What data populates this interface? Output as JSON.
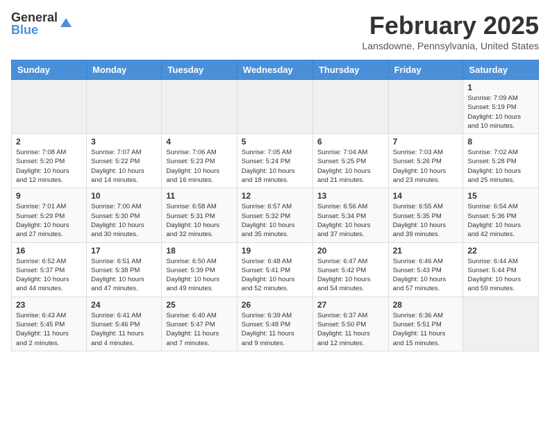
{
  "header": {
    "logo_general": "General",
    "logo_blue": "Blue",
    "month_title": "February 2025",
    "location": "Lansdowne, Pennsylvania, United States"
  },
  "days_of_week": [
    "Sunday",
    "Monday",
    "Tuesday",
    "Wednesday",
    "Thursday",
    "Friday",
    "Saturday"
  ],
  "weeks": [
    [
      {
        "day": "",
        "info": ""
      },
      {
        "day": "",
        "info": ""
      },
      {
        "day": "",
        "info": ""
      },
      {
        "day": "",
        "info": ""
      },
      {
        "day": "",
        "info": ""
      },
      {
        "day": "",
        "info": ""
      },
      {
        "day": "1",
        "info": "Sunrise: 7:09 AM\nSunset: 5:19 PM\nDaylight: 10 hours\nand 10 minutes."
      }
    ],
    [
      {
        "day": "2",
        "info": "Sunrise: 7:08 AM\nSunset: 5:20 PM\nDaylight: 10 hours\nand 12 minutes."
      },
      {
        "day": "3",
        "info": "Sunrise: 7:07 AM\nSunset: 5:22 PM\nDaylight: 10 hours\nand 14 minutes."
      },
      {
        "day": "4",
        "info": "Sunrise: 7:06 AM\nSunset: 5:23 PM\nDaylight: 10 hours\nand 16 minutes."
      },
      {
        "day": "5",
        "info": "Sunrise: 7:05 AM\nSunset: 5:24 PM\nDaylight: 10 hours\nand 18 minutes."
      },
      {
        "day": "6",
        "info": "Sunrise: 7:04 AM\nSunset: 5:25 PM\nDaylight: 10 hours\nand 21 minutes."
      },
      {
        "day": "7",
        "info": "Sunrise: 7:03 AM\nSunset: 5:26 PM\nDaylight: 10 hours\nand 23 minutes."
      },
      {
        "day": "8",
        "info": "Sunrise: 7:02 AM\nSunset: 5:28 PM\nDaylight: 10 hours\nand 25 minutes."
      }
    ],
    [
      {
        "day": "9",
        "info": "Sunrise: 7:01 AM\nSunset: 5:29 PM\nDaylight: 10 hours\nand 27 minutes."
      },
      {
        "day": "10",
        "info": "Sunrise: 7:00 AM\nSunset: 5:30 PM\nDaylight: 10 hours\nand 30 minutes."
      },
      {
        "day": "11",
        "info": "Sunrise: 6:58 AM\nSunset: 5:31 PM\nDaylight: 10 hours\nand 32 minutes."
      },
      {
        "day": "12",
        "info": "Sunrise: 6:57 AM\nSunset: 5:32 PM\nDaylight: 10 hours\nand 35 minutes."
      },
      {
        "day": "13",
        "info": "Sunrise: 6:56 AM\nSunset: 5:34 PM\nDaylight: 10 hours\nand 37 minutes."
      },
      {
        "day": "14",
        "info": "Sunrise: 6:55 AM\nSunset: 5:35 PM\nDaylight: 10 hours\nand 39 minutes."
      },
      {
        "day": "15",
        "info": "Sunrise: 6:54 AM\nSunset: 5:36 PM\nDaylight: 10 hours\nand 42 minutes."
      }
    ],
    [
      {
        "day": "16",
        "info": "Sunrise: 6:52 AM\nSunset: 5:37 PM\nDaylight: 10 hours\nand 44 minutes."
      },
      {
        "day": "17",
        "info": "Sunrise: 6:51 AM\nSunset: 5:38 PM\nDaylight: 10 hours\nand 47 minutes."
      },
      {
        "day": "18",
        "info": "Sunrise: 6:50 AM\nSunset: 5:39 PM\nDaylight: 10 hours\nand 49 minutes."
      },
      {
        "day": "19",
        "info": "Sunrise: 6:48 AM\nSunset: 5:41 PM\nDaylight: 10 hours\nand 52 minutes."
      },
      {
        "day": "20",
        "info": "Sunrise: 6:47 AM\nSunset: 5:42 PM\nDaylight: 10 hours\nand 54 minutes."
      },
      {
        "day": "21",
        "info": "Sunrise: 6:46 AM\nSunset: 5:43 PM\nDaylight: 10 hours\nand 57 minutes."
      },
      {
        "day": "22",
        "info": "Sunrise: 6:44 AM\nSunset: 5:44 PM\nDaylight: 10 hours\nand 59 minutes."
      }
    ],
    [
      {
        "day": "23",
        "info": "Sunrise: 6:43 AM\nSunset: 5:45 PM\nDaylight: 11 hours\nand 2 minutes."
      },
      {
        "day": "24",
        "info": "Sunrise: 6:41 AM\nSunset: 5:46 PM\nDaylight: 11 hours\nand 4 minutes."
      },
      {
        "day": "25",
        "info": "Sunrise: 6:40 AM\nSunset: 5:47 PM\nDaylight: 11 hours\nand 7 minutes."
      },
      {
        "day": "26",
        "info": "Sunrise: 6:39 AM\nSunset: 5:48 PM\nDaylight: 11 hours\nand 9 minutes."
      },
      {
        "day": "27",
        "info": "Sunrise: 6:37 AM\nSunset: 5:50 PM\nDaylight: 11 hours\nand 12 minutes."
      },
      {
        "day": "28",
        "info": "Sunrise: 6:36 AM\nSunset: 5:51 PM\nDaylight: 11 hours\nand 15 minutes."
      },
      {
        "day": "",
        "info": ""
      }
    ]
  ]
}
